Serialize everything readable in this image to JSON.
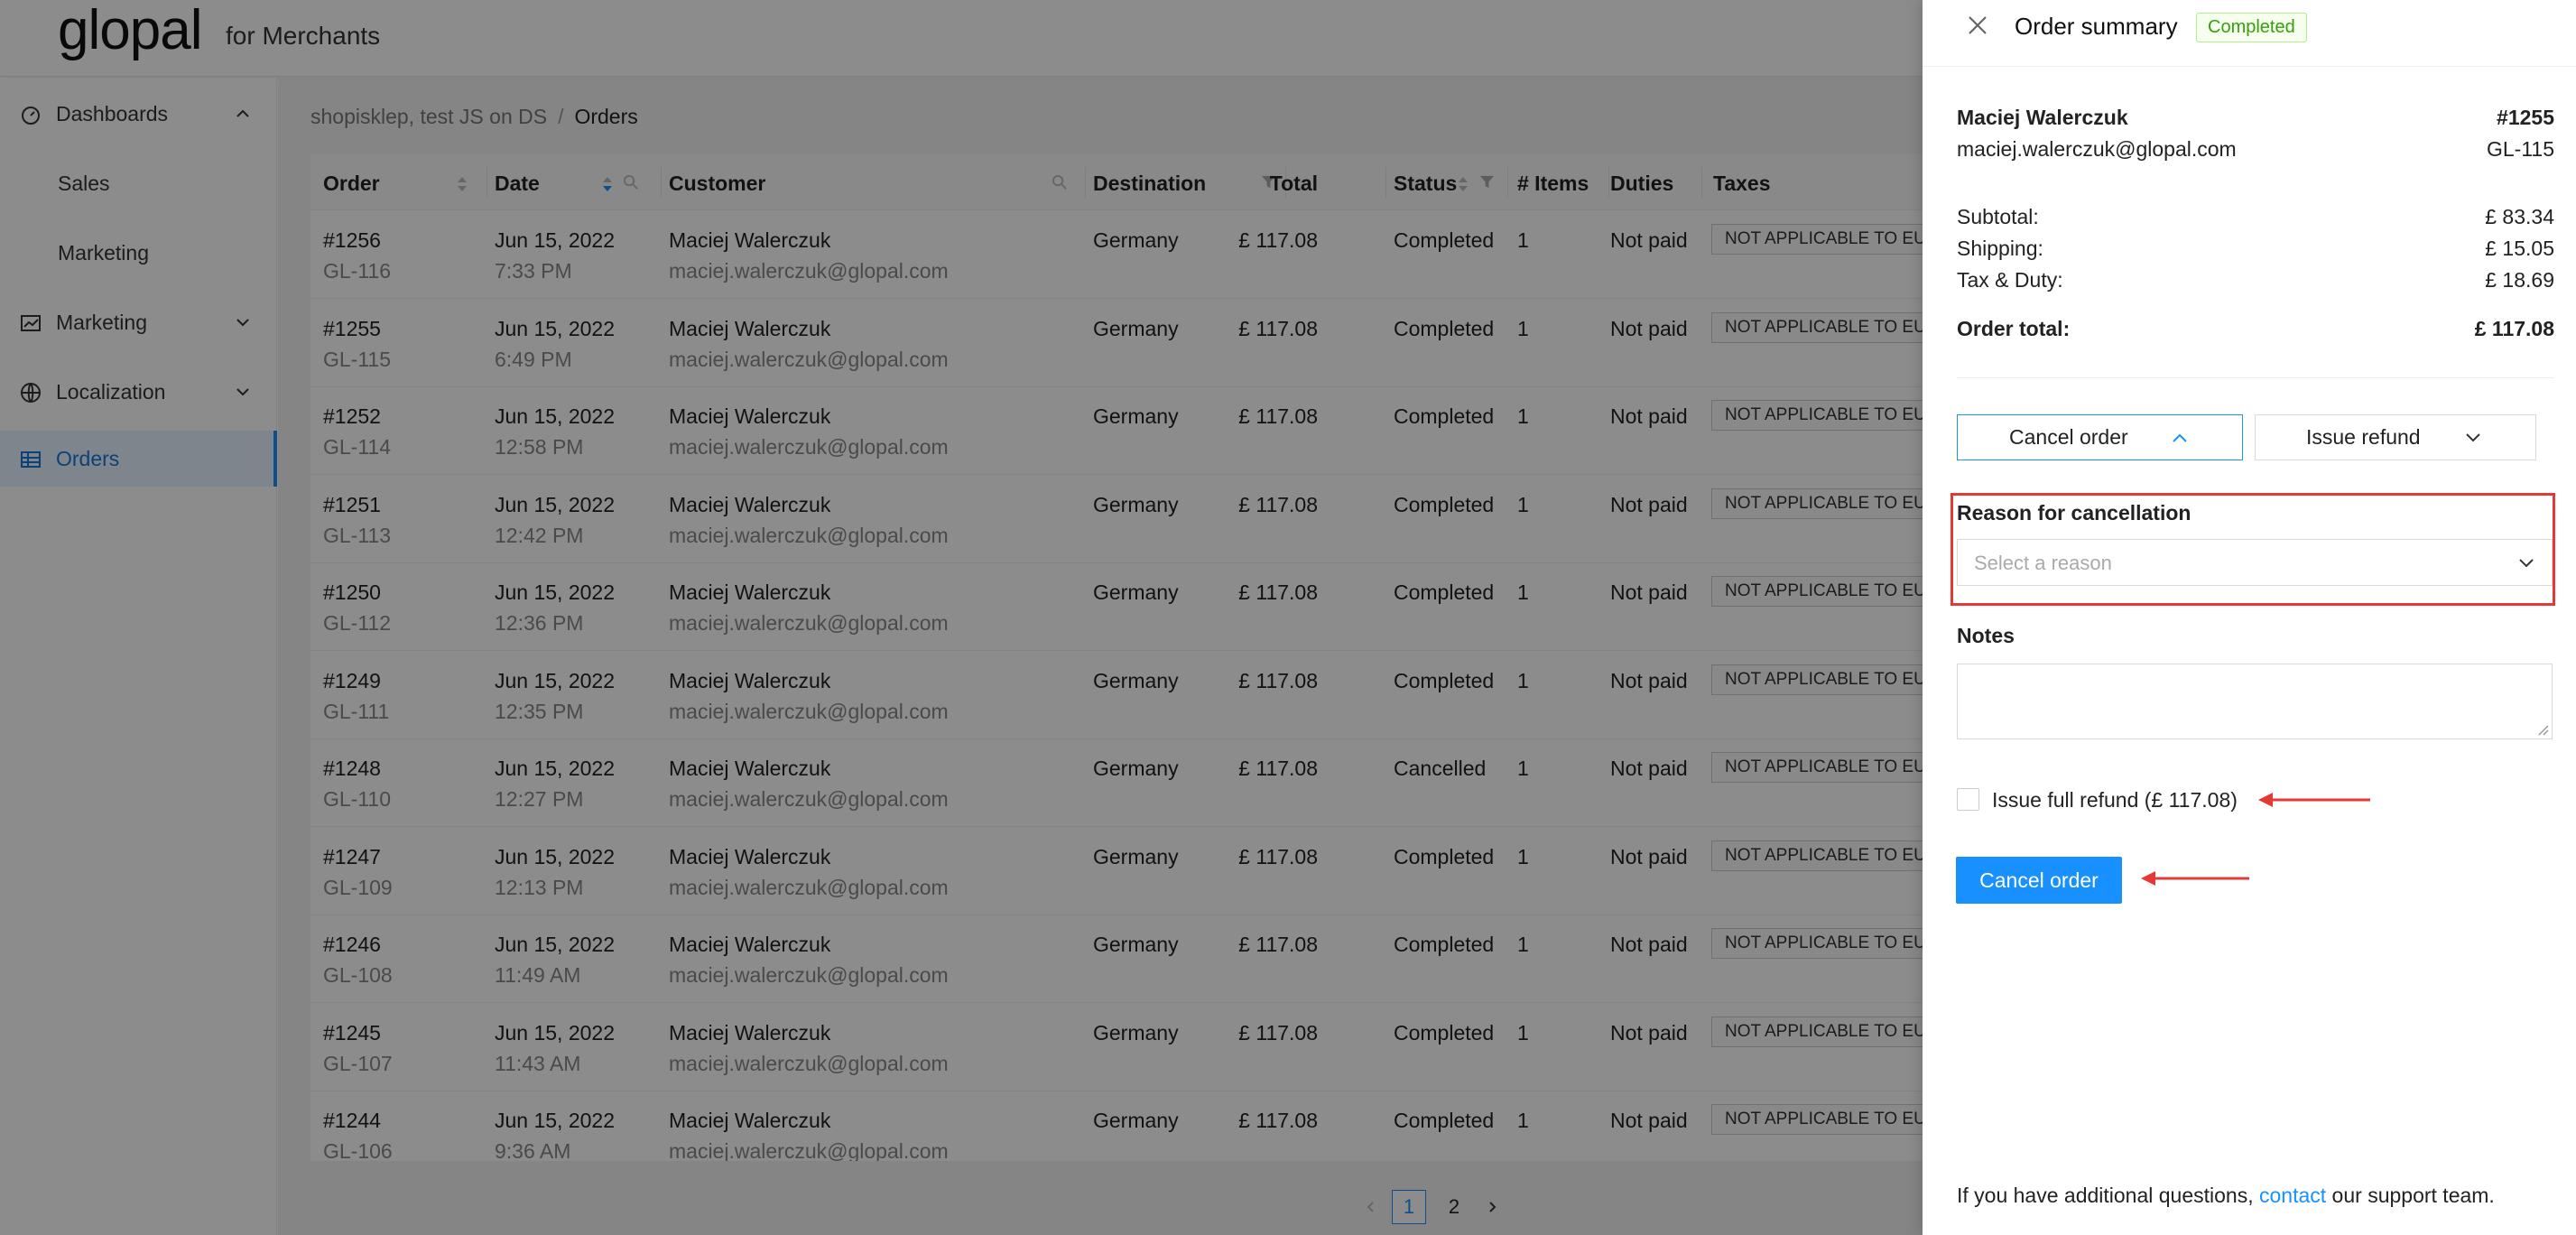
{
  "header": {
    "logo": "glopal",
    "logo_sub": "for Merchants"
  },
  "sidebar": {
    "items": [
      {
        "label": "Dashboards",
        "icon": "dashboard-icon",
        "expanded": true
      },
      {
        "label": "Sales",
        "sub": true
      },
      {
        "label": "Marketing",
        "sub": true
      },
      {
        "label": "Marketing",
        "icon": "line-chart-icon",
        "expanded": false
      },
      {
        "label": "Localization",
        "icon": "globe-icon",
        "expanded": false
      },
      {
        "label": "Orders",
        "icon": "table-icon",
        "active": true
      }
    ]
  },
  "breadcrumb": {
    "parent": "shopisklep, test JS on DS",
    "separator": "/",
    "current": "Orders"
  },
  "table": {
    "columns": [
      "Order",
      "Date",
      "Customer",
      "Destination",
      "Total",
      "Status",
      "# Items",
      "Duties",
      "Taxes"
    ],
    "rows": [
      {
        "order": "#1256",
        "gl": "GL-116",
        "date": "Jun 15, 2022",
        "time": "7:33 PM",
        "customer": "Maciej Walerczuk",
        "email": "maciej.walerczuk@glopal.com",
        "destination": "Germany",
        "total": "£ 117.08",
        "status": "Completed",
        "items": "1",
        "duties": "Not paid",
        "taxes": "NOT APPLICABLE TO EU"
      },
      {
        "order": "#1255",
        "gl": "GL-115",
        "date": "Jun 15, 2022",
        "time": "6:49 PM",
        "customer": "Maciej Walerczuk",
        "email": "maciej.walerczuk@glopal.com",
        "destination": "Germany",
        "total": "£ 117.08",
        "status": "Completed",
        "items": "1",
        "duties": "Not paid",
        "taxes": "NOT APPLICABLE TO EU"
      },
      {
        "order": "#1252",
        "gl": "GL-114",
        "date": "Jun 15, 2022",
        "time": "12:58 PM",
        "customer": "Maciej Walerczuk",
        "email": "maciej.walerczuk@glopal.com",
        "destination": "Germany",
        "total": "£ 117.08",
        "status": "Completed",
        "items": "1",
        "duties": "Not paid",
        "taxes": "NOT APPLICABLE TO EU"
      },
      {
        "order": "#1251",
        "gl": "GL-113",
        "date": "Jun 15, 2022",
        "time": "12:42 PM",
        "customer": "Maciej Walerczuk",
        "email": "maciej.walerczuk@glopal.com",
        "destination": "Germany",
        "total": "£ 117.08",
        "status": "Completed",
        "items": "1",
        "duties": "Not paid",
        "taxes": "NOT APPLICABLE TO EU"
      },
      {
        "order": "#1250",
        "gl": "GL-112",
        "date": "Jun 15, 2022",
        "time": "12:36 PM",
        "customer": "Maciej Walerczuk",
        "email": "maciej.walerczuk@glopal.com",
        "destination": "Germany",
        "total": "£ 117.08",
        "status": "Completed",
        "items": "1",
        "duties": "Not paid",
        "taxes": "NOT APPLICABLE TO EU"
      },
      {
        "order": "#1249",
        "gl": "GL-111",
        "date": "Jun 15, 2022",
        "time": "12:35 PM",
        "customer": "Maciej Walerczuk",
        "email": "maciej.walerczuk@glopal.com",
        "destination": "Germany",
        "total": "£ 117.08",
        "status": "Completed",
        "items": "1",
        "duties": "Not paid",
        "taxes": "NOT APPLICABLE TO EU"
      },
      {
        "order": "#1248",
        "gl": "GL-110",
        "date": "Jun 15, 2022",
        "time": "12:27 PM",
        "customer": "Maciej Walerczuk",
        "email": "maciej.walerczuk@glopal.com",
        "destination": "Germany",
        "total": "£ 117.08",
        "status": "Cancelled",
        "items": "1",
        "duties": "Not paid",
        "taxes": "NOT APPLICABLE TO EU"
      },
      {
        "order": "#1247",
        "gl": "GL-109",
        "date": "Jun 15, 2022",
        "time": "12:13 PM",
        "customer": "Maciej Walerczuk",
        "email": "maciej.walerczuk@glopal.com",
        "destination": "Germany",
        "total": "£ 117.08",
        "status": "Completed",
        "items": "1",
        "duties": "Not paid",
        "taxes": "NOT APPLICABLE TO EU"
      },
      {
        "order": "#1246",
        "gl": "GL-108",
        "date": "Jun 15, 2022",
        "time": "11:49 AM",
        "customer": "Maciej Walerczuk",
        "email": "maciej.walerczuk@glopal.com",
        "destination": "Germany",
        "total": "£ 117.08",
        "status": "Completed",
        "items": "1",
        "duties": "Not paid",
        "taxes": "NOT APPLICABLE TO EU"
      },
      {
        "order": "#1245",
        "gl": "GL-107",
        "date": "Jun 15, 2022",
        "time": "11:43 AM",
        "customer": "Maciej Walerczuk",
        "email": "maciej.walerczuk@glopal.com",
        "destination": "Germany",
        "total": "£ 117.08",
        "status": "Completed",
        "items": "1",
        "duties": "Not paid",
        "taxes": "NOT APPLICABLE TO EU"
      },
      {
        "order": "#1244",
        "gl": "GL-106",
        "date": "Jun 15, 2022",
        "time": "9:36 AM",
        "customer": "Maciej Walerczuk",
        "email": "maciej.walerczuk@glopal.com",
        "destination": "Germany",
        "total": "£ 117.08",
        "status": "Completed",
        "items": "1",
        "duties": "Not paid",
        "taxes": "NOT APPLICABLE TO EU"
      }
    ]
  },
  "pagination": {
    "pages": [
      "1",
      "2"
    ],
    "current": "1"
  },
  "drawer": {
    "title": "Order summary",
    "status": "Completed",
    "customer_name": "Maciej Walerczuk",
    "customer_email": "maciej.walerczuk@glopal.com",
    "order_number": "#1255",
    "gl_number": "GL-115",
    "subtotal_label": "Subtotal:",
    "subtotal": "£ 83.34",
    "shipping_label": "Shipping:",
    "shipping": "£ 15.05",
    "tax_label": "Tax & Duty:",
    "tax": "£ 18.69",
    "total_label": "Order total:",
    "total": "£ 117.08",
    "cancel_toggle_label": "Cancel order",
    "refund_toggle_label": "Issue refund",
    "reason_label": "Reason for cancellation",
    "reason_placeholder": "Select a reason",
    "notes_label": "Notes",
    "full_refund_label": "Issue full refund (£ 117.08)",
    "full_refund_checked": false,
    "submit_label": "Cancel order",
    "footer_prefix": "If you have additional questions, ",
    "footer_link": "contact",
    "footer_suffix": " our support team."
  },
  "colors": {
    "accent": "#1890ff",
    "annotation": "#e53935",
    "status_ok": "#389e0d"
  }
}
